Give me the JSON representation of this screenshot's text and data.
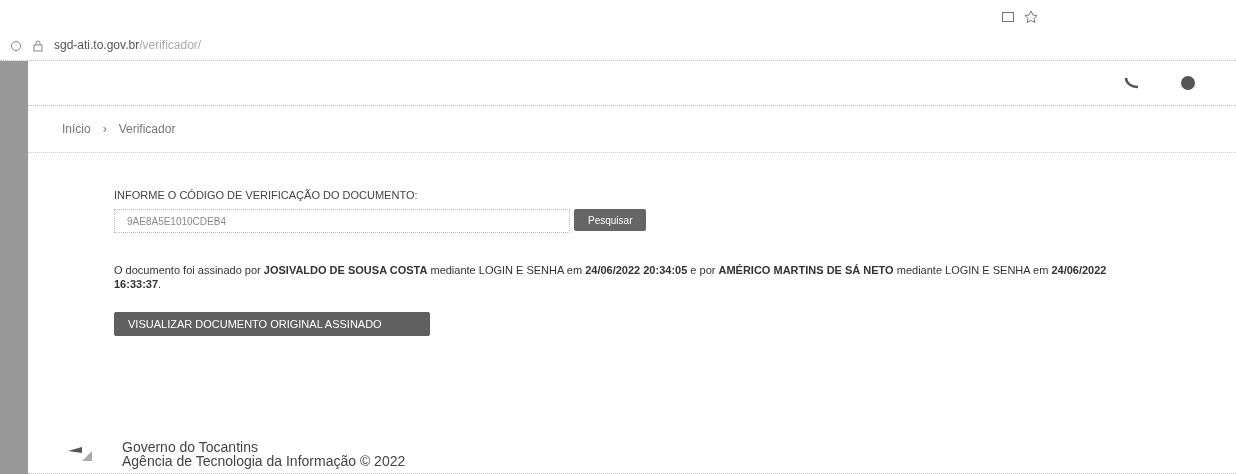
{
  "browser": {
    "url_host": "sgd-ati.to.gov.br",
    "url_path": "/verificador/"
  },
  "breadcrumb": [
    {
      "label": "Início"
    },
    {
      "label": "Verificador"
    }
  ],
  "breadcrumb_separator": "›",
  "form": {
    "label": "INFORME O CÓDIGO DE VERIFICAÇÃO DO DOCUMENTO:",
    "code": "9AE8A5E1010CDEB4",
    "search_button": "Pesquisar"
  },
  "result": "O documento foi assinado por **JOSIVALDO DE SOUSA COSTA** mediante LOGIN E SENHA em **24/06/2022 20:34:05** e por **AMÉRICO MARTINS DE SÁ NETO** mediante LOGIN E SENHA em **24/06/2022 16:33:37**.",
  "view_button": "VISUALIZAR DOCUMENTO ORIGINAL ASSINADO",
  "footer": {
    "line1": "Governo do Tocantins",
    "line2": "Agência de Tecnologia da Informação © 2022"
  }
}
